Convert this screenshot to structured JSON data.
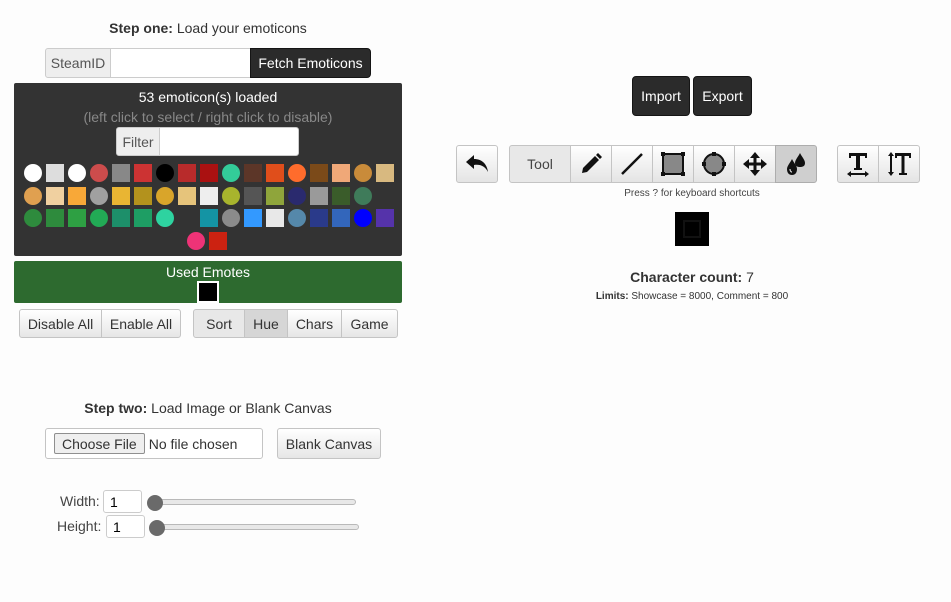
{
  "step_one": {
    "bold": "Step one:",
    "text": " Load your emoticons"
  },
  "steamid": {
    "label": "SteamID",
    "value": "",
    "fetch_label": "Fetch Emoticons"
  },
  "emoticons": {
    "loaded_text": "53 emoticon(s) loaded",
    "hint_text": "(left click to select / right click to disable)",
    "filter_label": "Filter",
    "filter_value": "",
    "row1": [
      "#ffffff",
      "#dddddd",
      "#ffffff",
      "#cc4c4c",
      "#888888",
      "#cc3333",
      "#000000",
      "#b82b2b",
      "#aa1111",
      "#33cc99",
      "#5c3628",
      "#e04e1b",
      "#ff6c2c",
      "#7b4a19",
      "#f0a878",
      "#c98b3a",
      "#d8b980"
    ],
    "row2": [
      "#e0a050",
      "#f0d0a0",
      "#f8a838",
      "#a0a0a0",
      "#e9b533",
      "#b3921d",
      "#d9a52a",
      "#e6c47b",
      "#eeeeee",
      "#a8b42d",
      "#555555",
      "#8fa53b",
      "#2a2a6e",
      "#9a9a9a",
      "#3a5c2a",
      "#3f7b5a"
    ],
    "row3": [
      "#2e8b3d",
      "#2e8b3d",
      "#2ea043",
      "#22aa55",
      "#1d8f6a",
      "#1e9e64",
      "#2ed3a0",
      "#333333",
      "#1494a4",
      "#8b8b8b",
      "#3399ff",
      "#e8e8e8",
      "#5588aa",
      "#2a3a8a",
      "#3366bb",
      "#0000ff",
      "#5533aa"
    ],
    "row4": [
      "#ee3377",
      "#cc2211"
    ]
  },
  "used_emotes": {
    "title": "Used Emotes",
    "color": "#000000"
  },
  "toggle_buttons": {
    "disable_all": "Disable All",
    "enable_all": "Enable All"
  },
  "sort_buttons": {
    "sort": "Sort",
    "hue": "Hue",
    "chars": "Chars",
    "game": "Game",
    "active": "Hue"
  },
  "step_two": {
    "bold": "Step two:",
    "text": " Load Image or Blank Canvas"
  },
  "file": {
    "button": "Choose File",
    "status": "No file chosen",
    "blank_canvas": "Blank Canvas"
  },
  "size": {
    "width_label": "Width:",
    "width_value": "1",
    "height_label": "Height:",
    "height_value": "1"
  },
  "io": {
    "import": "Import",
    "export": "Export"
  },
  "toolbar": {
    "tool_label": "Tool",
    "icons": [
      "undo-icon",
      "pencil-icon",
      "line-icon",
      "rectangle-icon",
      "circle-icon",
      "move-icon",
      "fill-drops-icon"
    ],
    "active_tool": "fill-drops-icon",
    "text_icons": [
      "text-width-icon",
      "text-height-icon"
    ],
    "shortcut_hint": "Press ? for keyboard shortcuts"
  },
  "canvas": {
    "pixel_color": "#000000"
  },
  "stats": {
    "char_count_label": "Character count:",
    "char_count_value": "7",
    "limits_label": "Limits:",
    "limits_text": "Showcase = 8000, Comment = 800"
  },
  "colors": {
    "dark_panel": "#333333",
    "used_panel": "#2d6a2f",
    "dark_button": "#2b2b2b"
  }
}
